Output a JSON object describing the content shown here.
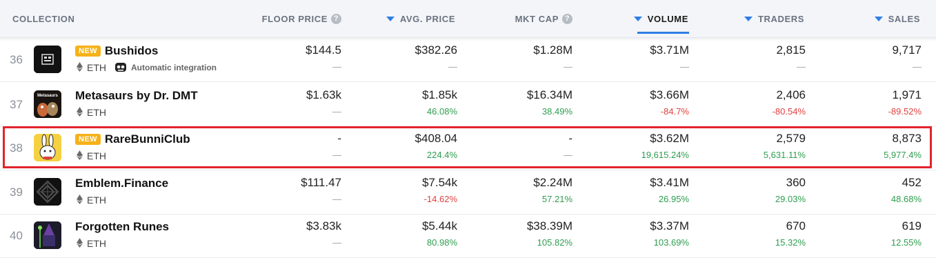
{
  "header": {
    "collection": "COLLECTION",
    "floor_price": "FLOOR PRICE",
    "avg_price": "AVG. PRICE",
    "mkt_cap": "MKT CAP",
    "volume": "VOLUME",
    "traders": "TRADERS",
    "sales": "SALES",
    "help_glyph": "?"
  },
  "colors": {
    "accent": "#2f7ee6",
    "positive": "#2e9d4f",
    "negative": "#e0413f",
    "badge": "#f6b21a",
    "highlight": "#e0242c"
  },
  "rows": [
    {
      "rank": "36",
      "badge": "NEW",
      "name": "Bushidos",
      "chain": "ETH",
      "integration": "Automatic integration",
      "floor": "$144.5",
      "floor_change": "—",
      "avg": "$382.26",
      "avg_change": "—",
      "mcap": "$1.28M",
      "mcap_change": "—",
      "volume": "$3.71M",
      "volume_change": "—",
      "traders": "2,815",
      "traders_change": "—",
      "sales": "9,717",
      "sales_change": "—"
    },
    {
      "rank": "37",
      "name": "Metasaurs by Dr. DMT",
      "chain": "ETH",
      "floor": "$1.63k",
      "floor_change": "—",
      "avg": "$1.85k",
      "avg_change": "46.08%",
      "mcap": "$16.34M",
      "mcap_change": "38.49%",
      "volume": "$3.66M",
      "volume_change": "-84.7%",
      "traders": "2,406",
      "traders_change": "-80.54%",
      "sales": "1,971",
      "sales_change": "-89.52%"
    },
    {
      "rank": "38",
      "badge": "NEW",
      "name": "RareBunniClub",
      "chain": "ETH",
      "floor": "-",
      "floor_change": "—",
      "avg": "$408.04",
      "avg_change": "224.4%",
      "mcap": "-",
      "mcap_change": "—",
      "volume": "$3.62M",
      "volume_change": "19,615.24%",
      "traders": "2,579",
      "traders_change": "5,631.11%",
      "sales": "8,873",
      "sales_change": "5,977.4%"
    },
    {
      "rank": "39",
      "name": "Emblem.Finance",
      "chain": "ETH",
      "floor": "$111.47",
      "floor_change": "—",
      "avg": "$7.54k",
      "avg_change": "-14.62%",
      "mcap": "$2.24M",
      "mcap_change": "57.21%",
      "volume": "$3.41M",
      "volume_change": "26.95%",
      "traders": "360",
      "traders_change": "29.03%",
      "sales": "452",
      "sales_change": "48.68%"
    },
    {
      "rank": "40",
      "name": "Forgotten Runes",
      "chain": "ETH",
      "floor": "$3.83k",
      "floor_change": "—",
      "avg": "$5.44k",
      "avg_change": "80.98%",
      "mcap": "$38.39M",
      "mcap_change": "105.82%",
      "volume": "$3.37M",
      "volume_change": "103.69%",
      "traders": "670",
      "traders_change": "15.32%",
      "sales": "619",
      "sales_change": "12.55%"
    }
  ],
  "thumb_text": {
    "metasaurs": "Metasaurs"
  }
}
